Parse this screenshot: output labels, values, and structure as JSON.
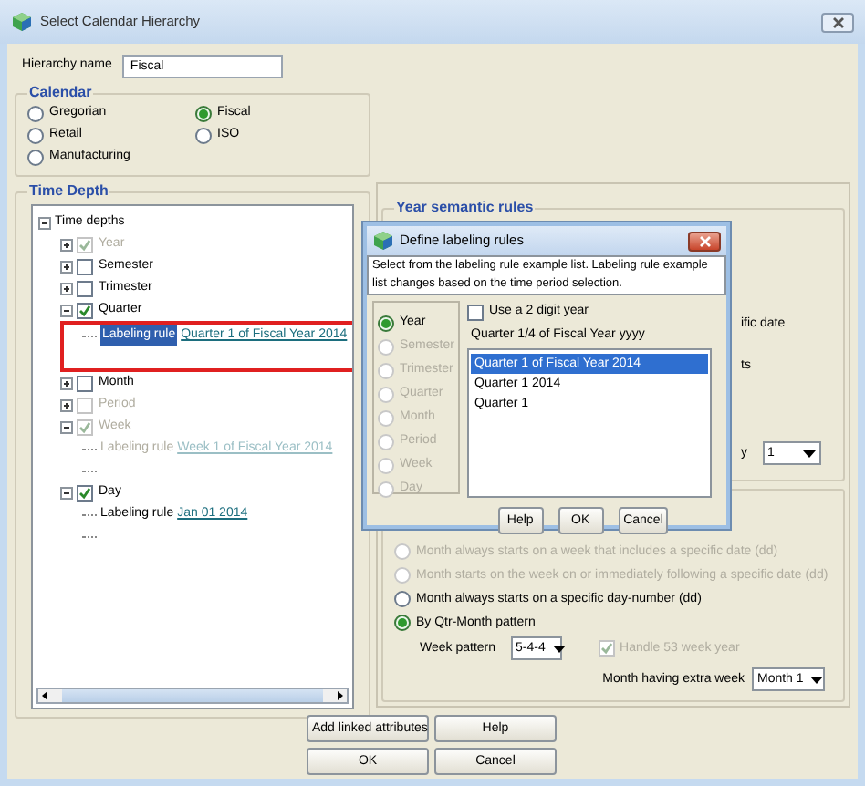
{
  "window": {
    "title": "Select Calendar Hierarchy"
  },
  "hierarchy_name": {
    "label": "Hierarchy name",
    "value": "Fiscal"
  },
  "calendar": {
    "title": "Calendar",
    "options": [
      {
        "label": "Gregorian",
        "selected": false
      },
      {
        "label": "Retail",
        "selected": false
      },
      {
        "label": "Manufacturing",
        "selected": false
      },
      {
        "label": "Fiscal",
        "selected": true
      },
      {
        "label": "ISO",
        "selected": false
      }
    ]
  },
  "time_depth": {
    "title": "Time Depth",
    "tree": {
      "label": "Time depths",
      "expanded": true,
      "children": [
        {
          "label": "Year",
          "checked": true,
          "disabled": true,
          "expanded": false
        },
        {
          "label": "Semester",
          "checked": false,
          "disabled": false,
          "expanded": false
        },
        {
          "label": "Trimester",
          "checked": false,
          "disabled": false,
          "expanded": false
        },
        {
          "label": "Quarter",
          "checked": true,
          "disabled": false,
          "expanded": true,
          "children": [
            {
              "kind": "rule",
              "label": "Labeling rule",
              "value": "Quarter 1 of Fiscal Year 2014",
              "selected": true,
              "disabled": false,
              "annotated": true
            }
          ]
        },
        {
          "label": "Month",
          "checked": false,
          "disabled": false,
          "expanded": false
        },
        {
          "label": "Period",
          "checked": false,
          "disabled": true,
          "expanded": false
        },
        {
          "label": "Week",
          "checked": true,
          "disabled": true,
          "expanded": true,
          "children": [
            {
              "kind": "rule",
              "label": "Labeling rule",
              "value": "Week 1 of Fiscal Year 2014",
              "selected": false,
              "disabled": true,
              "annotated": false
            }
          ]
        },
        {
          "label": "Day",
          "checked": true,
          "disabled": false,
          "expanded": true,
          "children": [
            {
              "kind": "rule",
              "label": "Labeling rule",
              "value": "Jan 01 2014",
              "selected": false,
              "disabled": false,
              "annotated": false
            }
          ]
        }
      ]
    }
  },
  "semantic_rules": {
    "title": "Year semantic rules",
    "fragments": [
      "ific date",
      "ts"
    ],
    "dropdown_label": "y",
    "dropdown_value": "1"
  },
  "month_rules": {
    "options": [
      {
        "label": "Month always starts on a week that includes a specific date (dd)",
        "selected": false,
        "disabled": true
      },
      {
        "label": "Month starts on the week on or immediately following a specific date (dd)",
        "selected": false,
        "disabled": true
      },
      {
        "label": "Month always starts on a specific day-number (dd)",
        "selected": false,
        "disabled": false
      },
      {
        "label": "By Qtr-Month pattern",
        "selected": true,
        "disabled": false
      }
    ],
    "week_pattern": {
      "label": "Week pattern",
      "value": "5-4-4"
    },
    "handle_53": {
      "label": "Handle 53 week year",
      "checked": true,
      "disabled": true
    },
    "extra_week": {
      "label": "Month having extra week",
      "value": "Month 1"
    }
  },
  "buttons": [
    "Add linked attributes",
    "Help",
    "OK",
    "Cancel"
  ],
  "labeling_dialog": {
    "title": "Define labeling rules",
    "description": "Select from the labeling rule example list. Labeling rule example list changes based on the time period selection.",
    "periods": [
      {
        "label": "Year",
        "selected": true,
        "disabled": false
      },
      {
        "label": "Semester",
        "selected": false,
        "disabled": true
      },
      {
        "label": "Trimester",
        "selected": false,
        "disabled": true
      },
      {
        "label": "Quarter",
        "selected": false,
        "disabled": true
      },
      {
        "label": "Month",
        "selected": false,
        "disabled": true
      },
      {
        "label": "Period",
        "selected": false,
        "disabled": true
      },
      {
        "label": "Week",
        "selected": false,
        "disabled": true
      },
      {
        "label": "Day",
        "selected": false,
        "disabled": true
      }
    ],
    "two_digit_year": {
      "label": "Use a 2 digit year",
      "checked": false
    },
    "format": "Quarter 1/4 of Fiscal Year yyyy",
    "examples": [
      {
        "label": "Quarter 1 of Fiscal Year 2014",
        "selected": true
      },
      {
        "label": "Quarter 1 2014",
        "selected": false
      },
      {
        "label": "Quarter 1",
        "selected": false
      }
    ],
    "buttons": [
      "Help",
      "OK",
      "Cancel"
    ]
  }
}
